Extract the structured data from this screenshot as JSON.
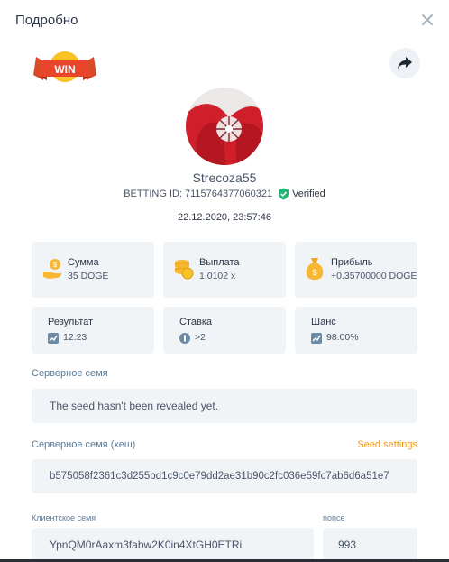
{
  "header": {
    "title": "Подробно"
  },
  "badge": {
    "text": "WIN"
  },
  "user": {
    "name": "Strecoza55",
    "betting_id_label": "BETTING ID:",
    "betting_id": "7115764377060321",
    "verified_label": "Verified"
  },
  "datetime": "22.12.2020, 23:57:46",
  "stats_row1": [
    {
      "label": "Сумма",
      "value": "35 DOGE",
      "icon": "money-hand-icon"
    },
    {
      "label": "Выплата",
      "value": "1.0102 x",
      "icon": "coins-stack-icon"
    },
    {
      "label": "Прибыль",
      "value": "+0.35700000 DOGE",
      "icon": "money-bag-icon"
    }
  ],
  "stats_row2": [
    {
      "label": "Результат",
      "value": "12.23",
      "icon": "chart-icon"
    },
    {
      "label": "Ставка",
      "value": ">2",
      "icon": "target-icon"
    },
    {
      "label": "Шанс",
      "value": "98.00%",
      "icon": "chart-icon"
    }
  ],
  "server_seed": {
    "label": "Серверное семя",
    "value": "The seed hasn't been revealed yet."
  },
  "server_seed_hash": {
    "label": "Серверное семя (хеш)",
    "settings_link": "Seed settings",
    "value": "b575058f2361c3d255bd1c9c0e79dd2ae31b90c2fc036e59fc7ab6d6a51e7"
  },
  "client_seed": {
    "label": "Клиентское семя",
    "value": "YpnQM0rAaxm3fabw2K0in4XtGH0ETRi"
  },
  "nonce": {
    "label": "nonce",
    "value": "993"
  },
  "colors": {
    "accent": "#f29a1a",
    "verified": "#22b573",
    "card_bg": "#f1f4f7",
    "label_blue": "#5c7a94"
  }
}
